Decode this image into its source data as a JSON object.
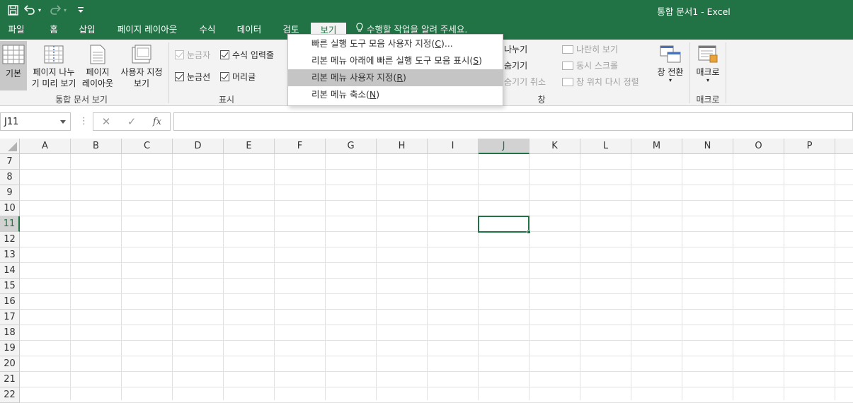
{
  "title_bar": {
    "document_title": "통합 문서1 - Excel",
    "qat_icons": [
      "save-icon",
      "undo-icon",
      "redo-icon",
      "customize-icon"
    ]
  },
  "tabs": [
    {
      "label": "파일"
    },
    {
      "label": "홈"
    },
    {
      "label": "삽입"
    },
    {
      "label": "페이지 레이아웃"
    },
    {
      "label": "수식"
    },
    {
      "label": "데이터"
    },
    {
      "label": "검토"
    },
    {
      "label": "보기",
      "active": true
    }
  ],
  "tell_me": "수행할 작업을 알려 주세요.",
  "ribbon": {
    "workbook_views": {
      "label": "통합 문서 보기",
      "normal": "기본",
      "page_break_1": "페이지 나누",
      "page_break_2": "기 미리 보기",
      "page_layout_1": "페이지",
      "page_layout_2": "레이아웃",
      "custom_views_1": "사용자 지정",
      "custom_views_2": "보기"
    },
    "show": {
      "label": "표시",
      "ruler": "눈금자",
      "formula_bar": "수식 입력줄",
      "gridlines": "눈금선",
      "headings": "머리글"
    },
    "window": {
      "label": "창",
      "split": "나누기",
      "hide": "숨기기",
      "unhide": "숨기기 취소",
      "side_by_side": "나란히 보기",
      "sync_scroll": "동시 스크롤",
      "reset_position": "창 위치 다시 정렬",
      "switch_windows": "창 전환"
    },
    "macros": {
      "label": "매크로",
      "button": "매크로"
    }
  },
  "dropdown": {
    "items": [
      {
        "text": "빠른 실행 도구 모음 사용자 지정(",
        "key": "C",
        "suffix": ")..."
      },
      {
        "text": "리본 메뉴 아래에 빠른 실행 도구 모음 표시(",
        "key": "S",
        "suffix": ")"
      },
      {
        "text": "리본 메뉴 사용자 지정(",
        "key": "R",
        "suffix": ")"
      },
      {
        "text": "리본 메뉴 축소(",
        "key": "N",
        "suffix": ")"
      }
    ]
  },
  "formula_bar": {
    "name_box": "J11",
    "cancel_icon": "cancel-icon",
    "enter_icon": "enter-icon",
    "fx_label": "fx",
    "formula_value": ""
  },
  "grid": {
    "columns": [
      "A",
      "B",
      "C",
      "D",
      "E",
      "F",
      "G",
      "H",
      "I",
      "J",
      "K",
      "L",
      "M",
      "N",
      "O",
      "P"
    ],
    "rows": [
      "7",
      "8",
      "9",
      "10",
      "11",
      "12",
      "13",
      "14",
      "15",
      "16",
      "17",
      "18",
      "19",
      "20",
      "21",
      "22"
    ],
    "selected_cell": "J11",
    "accent_color": "#217346"
  }
}
